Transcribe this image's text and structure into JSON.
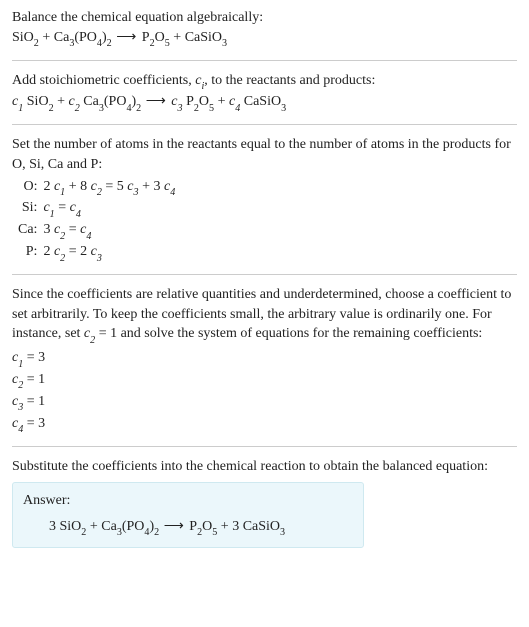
{
  "intro": "Balance the chemical equation algebraically:",
  "reaction1": {
    "lhs": [
      {
        "coef": "",
        "formula": [
          {
            "t": "SiO"
          },
          {
            "s": "2"
          }
        ]
      },
      {
        "coef": "",
        "formula": [
          {
            "t": "Ca"
          },
          {
            "s": "3"
          },
          {
            "t": "(PO"
          },
          {
            "s": "4"
          },
          {
            "t": ")"
          },
          {
            "s": "2"
          }
        ]
      }
    ],
    "rhs": [
      {
        "coef": "",
        "formula": [
          {
            "t": "P"
          },
          {
            "s": "2"
          },
          {
            "t": "O"
          },
          {
            "s": "5"
          }
        ]
      },
      {
        "coef": "",
        "formula": [
          {
            "t": "CaSiO"
          },
          {
            "s": "3"
          }
        ]
      }
    ]
  },
  "step2_text_a": "Add stoichiometric coefficients, ",
  "step2_ci": "c",
  "step2_ci_sub": "i",
  "step2_text_b": ", to the reactants and products:",
  "reaction2": {
    "lhs": [
      {
        "coef": {
          "v": "c",
          "s": "1"
        },
        "formula": [
          {
            "t": "SiO"
          },
          {
            "s": "2"
          }
        ]
      },
      {
        "coef": {
          "v": "c",
          "s": "2"
        },
        "formula": [
          {
            "t": "Ca"
          },
          {
            "s": "3"
          },
          {
            "t": "(PO"
          },
          {
            "s": "4"
          },
          {
            "t": ")"
          },
          {
            "s": "2"
          }
        ]
      }
    ],
    "rhs": [
      {
        "coef": {
          "v": "c",
          "s": "3"
        },
        "formula": [
          {
            "t": "P"
          },
          {
            "s": "2"
          },
          {
            "t": "O"
          },
          {
            "s": "5"
          }
        ]
      },
      {
        "coef": {
          "v": "c",
          "s": "4"
        },
        "formula": [
          {
            "t": "CaSiO"
          },
          {
            "s": "3"
          }
        ]
      }
    ]
  },
  "step3_text": "Set the number of atoms in the reactants equal to the number of atoms in the products for O, Si, Ca and P:",
  "eq_rows": [
    {
      "elt": "O:",
      "lhs": [
        {
          "n": "2 ",
          "c": "c",
          "s": "1"
        },
        {
          "plus": " + "
        },
        {
          "n": "8 ",
          "c": "c",
          "s": "2"
        }
      ],
      "eq": " = ",
      "rhs": [
        {
          "n": "5 ",
          "c": "c",
          "s": "3"
        },
        {
          "plus": " + "
        },
        {
          "n": "3 ",
          "c": "c",
          "s": "4"
        }
      ]
    },
    {
      "elt": "Si:",
      "lhs": [
        {
          "n": "",
          "c": "c",
          "s": "1"
        }
      ],
      "eq": " = ",
      "rhs": [
        {
          "n": "",
          "c": "c",
          "s": "4"
        }
      ]
    },
    {
      "elt": "Ca:",
      "lhs": [
        {
          "n": "3 ",
          "c": "c",
          "s": "2"
        }
      ],
      "eq": " = ",
      "rhs": [
        {
          "n": "",
          "c": "c",
          "s": "4"
        }
      ]
    },
    {
      "elt": "P:",
      "lhs": [
        {
          "n": "2 ",
          "c": "c",
          "s": "2"
        }
      ],
      "eq": " = ",
      "rhs": [
        {
          "n": "2 ",
          "c": "c",
          "s": "3"
        }
      ]
    }
  ],
  "step4_text_a": "Since the coefficients are relative quantities and underdetermined, choose a coefficient to set arbitrarily. To keep the coefficients small, the arbitrary value is ordinarily one. For instance, set ",
  "step4_set": {
    "c": "c",
    "s": "2",
    "val": " = 1"
  },
  "step4_text_b": " and solve the system of equations for the remaining coefficients:",
  "coefs": [
    {
      "c": "c",
      "s": "1",
      "val": " = 3"
    },
    {
      "c": "c",
      "s": "2",
      "val": " = 1"
    },
    {
      "c": "c",
      "s": "3",
      "val": " = 1"
    },
    {
      "c": "c",
      "s": "4",
      "val": " = 3"
    }
  ],
  "step5_text": "Substitute the coefficients into the chemical reaction to obtain the balanced equation:",
  "answer_label": "Answer:",
  "reaction_final": {
    "lhs": [
      {
        "num": "3 ",
        "formula": [
          {
            "t": "SiO"
          },
          {
            "s": "2"
          }
        ]
      },
      {
        "num": "",
        "formula": [
          {
            "t": "Ca"
          },
          {
            "s": "3"
          },
          {
            "t": "(PO"
          },
          {
            "s": "4"
          },
          {
            "t": ")"
          },
          {
            "s": "2"
          }
        ]
      }
    ],
    "rhs": [
      {
        "num": "",
        "formula": [
          {
            "t": "P"
          },
          {
            "s": "2"
          },
          {
            "t": "O"
          },
          {
            "s": "5"
          }
        ]
      },
      {
        "num": "3 ",
        "formula": [
          {
            "t": "CaSiO"
          },
          {
            "s": "3"
          }
        ]
      }
    ]
  },
  "chart_data": {
    "type": "table",
    "title": "Atom balance equations",
    "rows": [
      {
        "element": "O",
        "equation": "2 c1 + 8 c2 = 5 c3 + 3 c4"
      },
      {
        "element": "Si",
        "equation": "c1 = c4"
      },
      {
        "element": "Ca",
        "equation": "3 c2 = c4"
      },
      {
        "element": "P",
        "equation": "2 c2 = 2 c3"
      }
    ],
    "solution": {
      "c1": 3,
      "c2": 1,
      "c3": 1,
      "c4": 3
    },
    "balanced_equation": "3 SiO2 + Ca3(PO4)2 -> P2O5 + 3 CaSiO3"
  }
}
